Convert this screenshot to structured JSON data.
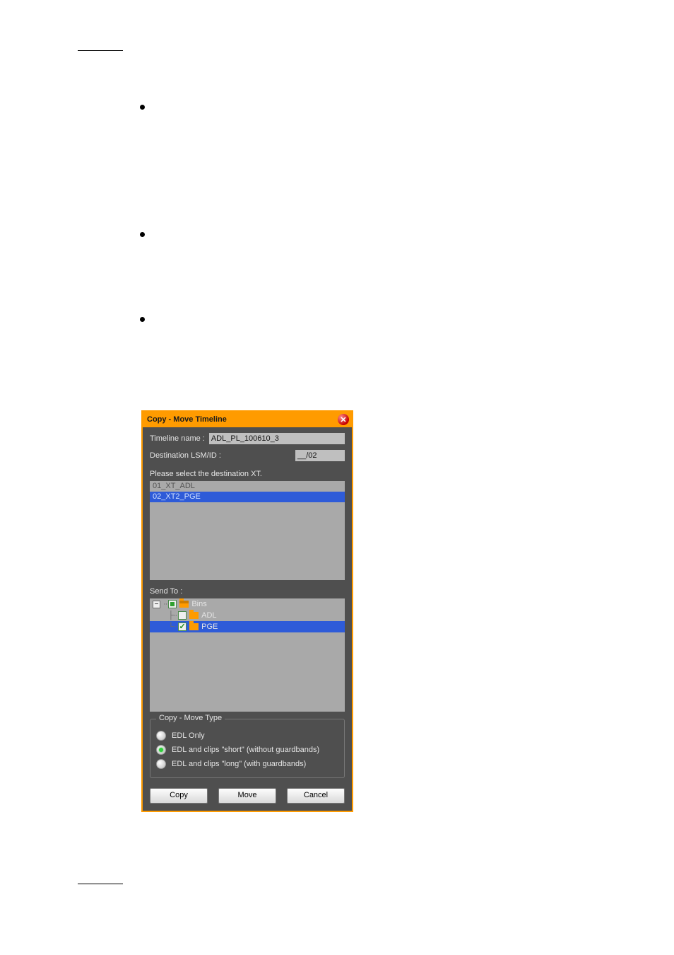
{
  "dialog": {
    "title": "Copy - Move Timeline",
    "timeline_name_label": "Timeline name :",
    "timeline_name_value": "ADL_PL_100610_3",
    "destination_label": "Destination LSM/ID :",
    "destination_value": "__/02",
    "select_dest_label": "Please select the destination XT.",
    "xt_list": [
      {
        "label": "01_XT_ADL",
        "selected": false
      },
      {
        "label": "02_XT2_PGE",
        "selected": true
      }
    ],
    "send_to_label": "Send To :",
    "tree": {
      "root": {
        "label": "Bins",
        "expanded": true,
        "check_state": "mixed",
        "children": [
          {
            "label": "ADL",
            "check_state": "unchecked",
            "selected": false
          },
          {
            "label": "PGE",
            "check_state": "checked",
            "selected": true
          }
        ]
      }
    },
    "copy_move_type": {
      "legend": "Copy - Move Type",
      "options": [
        {
          "label": "EDL Only",
          "selected": false
        },
        {
          "label": "EDL and clips \"short\" (without guardbands)",
          "selected": true
        },
        {
          "label": "EDL and clips \"long\" (with guardbands)",
          "selected": false
        }
      ]
    },
    "buttons": {
      "copy": "Copy",
      "move": "Move",
      "cancel": "Cancel"
    }
  },
  "colors": {
    "accent": "#ff9b00",
    "dialog_bg": "#4f4f4f",
    "list_bg": "#a9a9a9",
    "selection": "#2e5bd8",
    "radio_selected": "#2ecf3a"
  }
}
